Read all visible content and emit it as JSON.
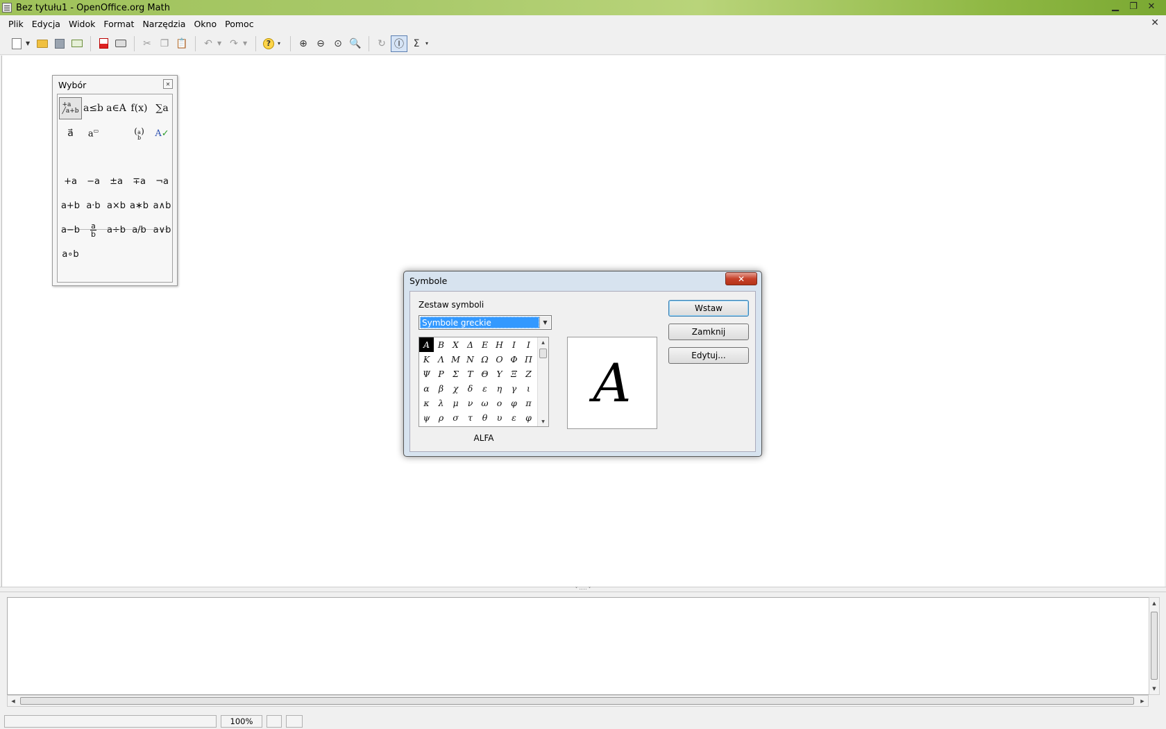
{
  "window": {
    "title": "Bez tytułu1 - OpenOffice.org Math"
  },
  "menu": [
    "Plik",
    "Edycja",
    "Widok",
    "Format",
    "Narzędzia",
    "Okno",
    "Pomoc"
  ],
  "toolbar": {
    "items": [
      "new-icon",
      "open-icon",
      "save-icon",
      "email-icon",
      "export-pdf-icon",
      "print-icon",
      "cut-icon",
      "copy-icon",
      "paste-icon",
      "undo-icon",
      "redo-icon",
      "help-icon",
      "zoom-in-icon",
      "zoom-out-icon",
      "zoom-100-icon",
      "show-all-icon",
      "update-icon",
      "formula-cursor-icon",
      "symbols-icon"
    ]
  },
  "selection_panel": {
    "title": "Wybór",
    "categories": [
      "+a/a+b",
      "a≤b",
      "a∈A",
      "f(x)",
      "∑a",
      "a⃗",
      "a⋯",
      "(a b)",
      "formatting"
    ],
    "operators": [
      [
        "+a",
        "−a",
        "±a",
        "∓a",
        "¬a"
      ],
      [
        "a+b",
        "a·b",
        "a×b",
        "a∗b",
        "a∧b"
      ],
      [
        "a−b",
        "a/b-frac",
        "a÷b",
        "a/b",
        "a∨b"
      ],
      [
        "a∘b"
      ]
    ],
    "frac": {
      "num": "a",
      "den": "b"
    }
  },
  "symbols_dialog": {
    "title": "Symbole",
    "set_label": "Zestaw symboli",
    "set_value": "Symbole greckie",
    "symbols": [
      [
        "Α",
        "Β",
        "Χ",
        "Δ",
        "Ε",
        "Η",
        "Ι",
        "Ι"
      ],
      [
        "Κ",
        "Λ",
        "Μ",
        "Ν",
        "Ω",
        "Ο",
        "Φ",
        "Π"
      ],
      [
        "Ψ",
        "Ρ",
        "Σ",
        "Τ",
        "Θ",
        "Υ",
        "Ξ",
        "Ζ"
      ],
      [
        "α",
        "β",
        "χ",
        "δ",
        "ε",
        "η",
        "γ",
        "ι"
      ],
      [
        "κ",
        "λ",
        "μ",
        "ν",
        "ω",
        "ο",
        "φ",
        "π"
      ],
      [
        "ψ",
        "ρ",
        "σ",
        "τ",
        "θ",
        "υ",
        "ε",
        "φ"
      ]
    ],
    "selected_name": "ALFA",
    "preview": "A",
    "buttons": {
      "insert": "Wstaw",
      "close": "Zamknij",
      "edit": "Edytuj..."
    }
  },
  "statusbar": {
    "zoom": "100%"
  }
}
